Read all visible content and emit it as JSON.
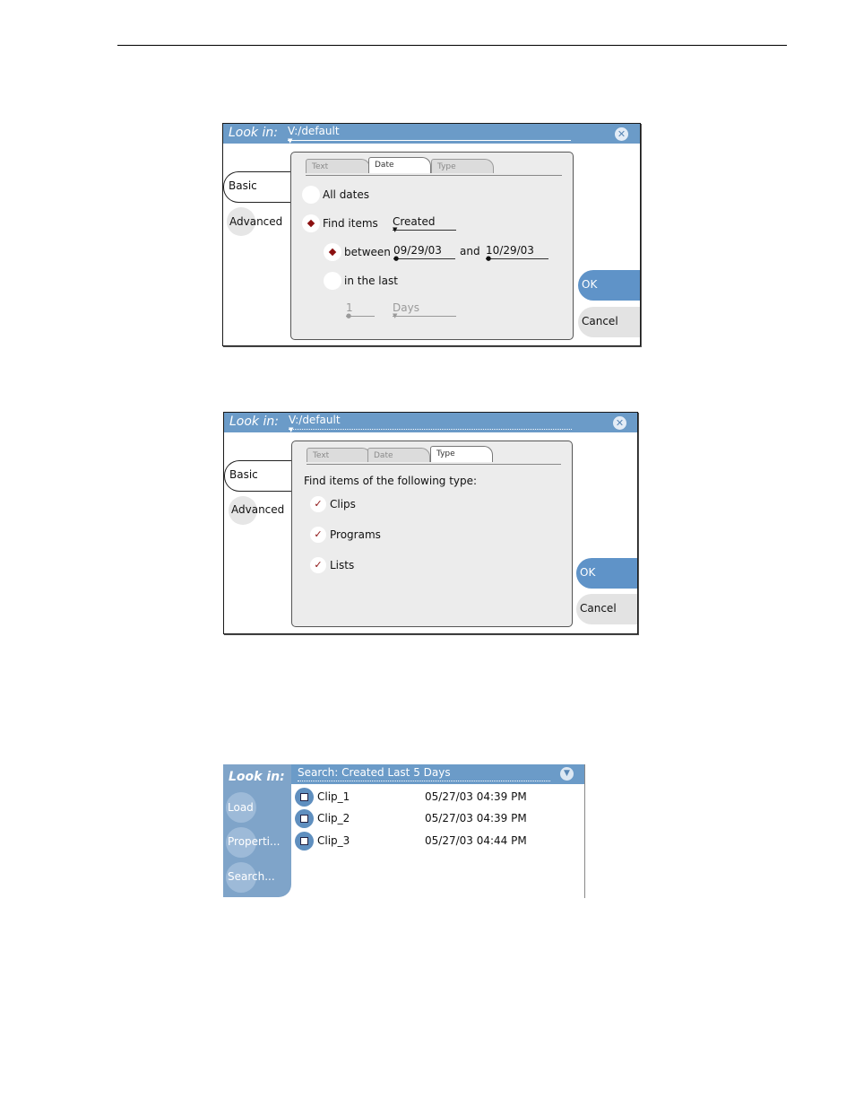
{
  "dialog1": {
    "lookin_label": "Look in:",
    "path": "V:/default",
    "close_glyph": "✕",
    "side_tabs": {
      "basic": "Basic",
      "advanced": "Advanced"
    },
    "tabs": [
      "Text",
      "Date",
      "Type"
    ],
    "active_tab": "Date",
    "all_dates": "All dates",
    "find_items": "Find items",
    "find_mode": "Created",
    "between": "between",
    "start_date": "09/29/03",
    "and": "and",
    "end_date": "10/29/03",
    "in_the_last": "in the last",
    "last_count": "1",
    "last_unit": "Days",
    "ok": "OK",
    "cancel": "Cancel"
  },
  "dialog2": {
    "lookin_label": "Look in:",
    "path": "V:/default",
    "close_glyph": "✕",
    "side_tabs": {
      "basic": "Basic",
      "advanced": "Advanced"
    },
    "tabs": [
      "Text",
      "Date",
      "Type"
    ],
    "active_tab": "Type",
    "heading": "Find items of the following type:",
    "types": [
      "Clips",
      "Programs",
      "Lists"
    ],
    "check_glyph": "✓",
    "ok": "OK",
    "cancel": "Cancel"
  },
  "bin": {
    "lookin_label": "Look in:",
    "search": "Search: Created Last 5 Days",
    "dropdown_glyph": "▼",
    "buttons": [
      "Load",
      "Properti...",
      "Search..."
    ],
    "items": [
      {
        "name": "Clip_1",
        "date": "05/27/03 04:39 PM"
      },
      {
        "name": "Clip_2",
        "date": "05/27/03 04:39 PM"
      },
      {
        "name": "Clip_3",
        "date": "05/27/03 04:44 PM"
      }
    ]
  },
  "colors": {
    "title_bar": "#6b9bc8",
    "ok_button": "#5f93c8",
    "radio_dot": "#8b1010",
    "panel": "#ececec"
  }
}
